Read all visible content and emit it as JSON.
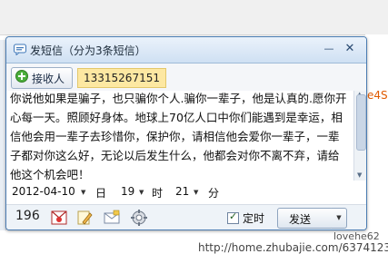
{
  "window": {
    "title": "发短信（分为3条短信）",
    "minimize_glyph": "—",
    "close_glyph": "✕"
  },
  "recipient": {
    "button_label": "接收人",
    "phone": "13315267151"
  },
  "message": {
    "text": "你说他如果是骗子，也只骗你个人.骗你一辈子，他是认真的.愿你开心每一天。照顾好身体。地球上70亿人口中你们能遇到是幸运，相信他会用一辈子去珍惜你，保护你，请相信他会爱你一辈子，一辈子都对你这么好，无论以后发生什么，他都会对你不离不弃，请给他这个机会吧！"
  },
  "schedule": {
    "date": "2012-04-10",
    "day_unit": "日",
    "hour": "19",
    "hour_unit": "时",
    "minute": "21",
    "minute_unit": "分",
    "dropdown_glyph": "▼"
  },
  "footer": {
    "char_count": "196",
    "timed_label": "定时",
    "timed_checked": true,
    "send_label": "发送",
    "icons": [
      "stamp-icon",
      "note-pencil-icon",
      "envelope-icon",
      "settings-gear-icon"
    ]
  },
  "background": {
    "right_fragment": "e4S",
    "watermark_user": "lovehe62",
    "watermark_url": "http://home.zhubajie.com/6374123/"
  },
  "colors": {
    "title_bar": "#cfe0f3",
    "phone_highlight": "#fde8a2",
    "border": "#4a7cb2",
    "accent_orange": "#e05a00"
  }
}
